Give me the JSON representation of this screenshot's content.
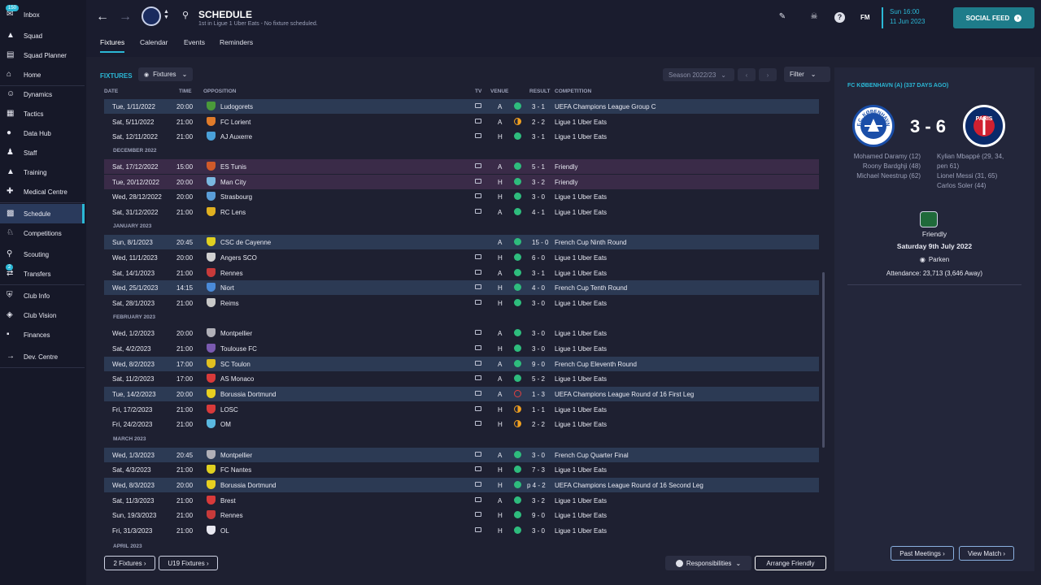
{
  "sidebar": [
    {
      "label": "Inbox",
      "badge": "150",
      "icon": "inbox-icon"
    },
    {
      "label": "Squad",
      "icon": "shirt-icon"
    },
    {
      "label": "Squad Planner",
      "icon": "clipboard-icon"
    },
    {
      "label": "Home",
      "icon": "home-icon"
    },
    {
      "label": "Dynamics",
      "icon": "dynamics-icon"
    },
    {
      "label": "Tactics",
      "icon": "tactics-icon"
    },
    {
      "label": "Data Hub",
      "icon": "data-hub-icon"
    },
    {
      "label": "Staff",
      "icon": "staff-icon"
    },
    {
      "label": "Training",
      "icon": "training-icon"
    },
    {
      "label": "Medical Centre",
      "icon": "medical-icon"
    },
    {
      "label": "Schedule",
      "icon": "calendar-icon"
    },
    {
      "label": "Competitions",
      "icon": "trophy-icon"
    },
    {
      "label": "Scouting",
      "icon": "scouting-icon"
    },
    {
      "label": "Transfers",
      "badge": "2",
      "icon": "transfers-icon"
    },
    {
      "label": "Club Info",
      "icon": "shield-icon"
    },
    {
      "label": "Club Vision",
      "icon": "vision-icon"
    },
    {
      "label": "Finances",
      "icon": "finances-icon"
    },
    {
      "label": "Dev. Centre",
      "icon": "dev-centre-icon"
    }
  ],
  "header": {
    "title": "SCHEDULE",
    "subtitle": "1st in Ligue 1 Uber Eats - No fixture scheduled.",
    "date_time": "Sun 16:00",
    "date": "11 Jun 2023",
    "social": "SOCIAL FEED",
    "fm": "FM"
  },
  "tabs": [
    "Fixtures",
    "Calendar",
    "Events",
    "Reminders"
  ],
  "main": {
    "section": "FIXTURES",
    "dropdown": "Fixtures",
    "season": "Season 2022/23",
    "filter": "Filter",
    "columns": {
      "date": "DATE",
      "time": "TIME",
      "opposition": "OPPOSITION",
      "tv": "TV",
      "venue": "VENUE",
      "result": "RESULT",
      "competition": "COMPETITION"
    }
  },
  "months": [
    "DECEMBER 2022",
    "JANUARY 2023",
    "FEBRUARY 2023",
    "MARCH 2023",
    "APRIL 2023"
  ],
  "fixtures": [
    {
      "date": "Tue, 1/11/2022",
      "time": "20:00",
      "opp": "Ludogorets",
      "venue": "A",
      "res": "3 - 1",
      "comp": "UEFA Champions League Group C",
      "dot": "#2ebc7d",
      "badge": "#4a9a3a",
      "style": "hl",
      "tv": true
    },
    {
      "date": "Sat, 5/11/2022",
      "time": "21:00",
      "opp": "FC Lorient",
      "venue": "A",
      "res": "2 - 2",
      "comp": "Ligue 1 Uber Eats",
      "dot": "half",
      "badge": "#e07b2a",
      "style": "",
      "tv": true
    },
    {
      "date": "Sat, 12/11/2022",
      "time": "21:00",
      "opp": "AJ Auxerre",
      "venue": "H",
      "res": "3 - 1",
      "comp": "Ligue 1 Uber Eats",
      "dot": "#2ebc7d",
      "badge": "#4aa0d8",
      "style": "",
      "tv": true
    },
    {
      "date": "Sat, 17/12/2022",
      "time": "15:00",
      "opp": "ES Tunis",
      "venue": "A",
      "res": "5 - 1",
      "comp": "Friendly",
      "dot": "#2ebc7d",
      "badge": "#d05a2a",
      "style": "pk",
      "tv": true
    },
    {
      "date": "Tue, 20/12/2022",
      "time": "20:00",
      "opp": "Man City",
      "venue": "H",
      "res": "3 - 2",
      "comp": "Friendly",
      "dot": "#2ebc7d",
      "badge": "#7ab8e0",
      "style": "pk",
      "tv": true
    },
    {
      "date": "Wed, 28/12/2022",
      "time": "20:00",
      "opp": "Strasbourg",
      "venue": "H",
      "res": "3 - 0",
      "comp": "Ligue 1 Uber Eats",
      "dot": "#2ebc7d",
      "badge": "#5a9ed8",
      "style": "",
      "tv": true
    },
    {
      "date": "Sat, 31/12/2022",
      "time": "21:00",
      "opp": "RC Lens",
      "venue": "A",
      "res": "4 - 1",
      "comp": "Ligue 1 Uber Eats",
      "dot": "#2ebc7d",
      "badge": "#e0b020",
      "style": "",
      "tv": true
    },
    {
      "date": "Sun, 8/1/2023",
      "time": "20:45",
      "opp": "CSC de Cayenne",
      "venue": "A",
      "res": "15 - 0",
      "comp": "French Cup Ninth Round",
      "dot": "#2ebc7d",
      "badge": "#e0d020",
      "style": "hl",
      "tv": false
    },
    {
      "date": "Wed, 11/1/2023",
      "time": "20:00",
      "opp": "Angers SCO",
      "venue": "H",
      "res": "6 - 0",
      "comp": "Ligue 1 Uber Eats",
      "dot": "#2ebc7d",
      "badge": "#d0d0d0",
      "style": "",
      "tv": true
    },
    {
      "date": "Sat, 14/1/2023",
      "time": "21:00",
      "opp": "Rennes",
      "venue": "A",
      "res": "3 - 1",
      "comp": "Ligue 1 Uber Eats",
      "dot": "#2ebc7d",
      "badge": "#c83a3a",
      "style": "",
      "tv": true
    },
    {
      "date": "Wed, 25/1/2023",
      "time": "14:15",
      "opp": "Niort",
      "venue": "H",
      "res": "4 - 0",
      "comp": "French Cup Tenth Round",
      "dot": "#2ebc7d",
      "badge": "#4a8ad8",
      "style": "hl",
      "tv": true
    },
    {
      "date": "Sat, 28/1/2023",
      "time": "21:00",
      "opp": "Reims",
      "venue": "H",
      "res": "3 - 0",
      "comp": "Ligue 1 Uber Eats",
      "dot": "#2ebc7d",
      "badge": "#c8c8c8",
      "style": "",
      "tv": true
    },
    {
      "date": "Wed, 1/2/2023",
      "time": "20:00",
      "opp": "Montpellier",
      "venue": "A",
      "res": "3 - 0",
      "comp": "Ligue 1 Uber Eats",
      "dot": "#2ebc7d",
      "badge": "#b0b0b8",
      "style": "",
      "tv": true
    },
    {
      "date": "Sat, 4/2/2023",
      "time": "21:00",
      "opp": "Toulouse FC",
      "venue": "H",
      "res": "3 - 0",
      "comp": "Ligue 1 Uber Eats",
      "dot": "#2ebc7d",
      "badge": "#7a5ab0",
      "style": "",
      "tv": true
    },
    {
      "date": "Wed, 8/2/2023",
      "time": "17:00",
      "opp": "SC Toulon",
      "venue": "A",
      "res": "9 - 0",
      "comp": "French Cup Eleventh Round",
      "dot": "#2ebc7d",
      "badge": "#e0c020",
      "style": "hl",
      "tv": true
    },
    {
      "date": "Sat, 11/2/2023",
      "time": "17:00",
      "opp": "AS Monaco",
      "venue": "A",
      "res": "5 - 2",
      "comp": "Ligue 1 Uber Eats",
      "dot": "#2ebc7d",
      "badge": "#d83a3a",
      "style": "",
      "tv": true
    },
    {
      "date": "Tue, 14/2/2023",
      "time": "20:00",
      "opp": "Borussia Dortmund",
      "venue": "A",
      "res": "1 - 3",
      "comp": "UEFA Champions League Round of 16  First Leg",
      "dot": "loss",
      "badge": "#e8d020",
      "style": "hl",
      "tv": true
    },
    {
      "date": "Fri, 17/2/2023",
      "time": "21:00",
      "opp": "LOSC",
      "venue": "H",
      "res": "1 - 1",
      "comp": "Ligue 1 Uber Eats",
      "dot": "half",
      "badge": "#d83a3a",
      "style": "",
      "tv": true
    },
    {
      "date": "Fri, 24/2/2023",
      "time": "21:00",
      "opp": "OM",
      "venue": "H",
      "res": "2 - 2",
      "comp": "Ligue 1 Uber Eats",
      "dot": "half",
      "badge": "#5ab8e0",
      "style": "",
      "tv": true
    },
    {
      "date": "Wed, 1/3/2023",
      "time": "20:45",
      "opp": "Montpellier",
      "venue": "A",
      "res": "3 - 0",
      "comp": "French Cup Quarter Final",
      "dot": "#2ebc7d",
      "badge": "#b0b0b8",
      "style": "hl",
      "tv": true
    },
    {
      "date": "Sat, 4/3/2023",
      "time": "21:00",
      "opp": "FC Nantes",
      "venue": "H",
      "res": "7 - 3",
      "comp": "Ligue 1 Uber Eats",
      "dot": "#2ebc7d",
      "badge": "#e0d020",
      "style": "",
      "tv": true
    },
    {
      "date": "Wed, 8/3/2023",
      "time": "20:00",
      "opp": "Borussia Dortmund",
      "venue": "H",
      "res": "p 4 - 2",
      "comp": "UEFA Champions League Round of 16  Second Leg",
      "dot": "#2ebc7d",
      "badge": "#e8d020",
      "style": "hl",
      "tv": true
    },
    {
      "date": "Sat, 11/3/2023",
      "time": "21:00",
      "opp": "Brest",
      "venue": "A",
      "res": "3 - 2",
      "comp": "Ligue 1 Uber Eats",
      "dot": "#2ebc7d",
      "badge": "#d83a3a",
      "style": "",
      "tv": true
    },
    {
      "date": "Sun, 19/3/2023",
      "time": "21:00",
      "opp": "Rennes",
      "venue": "H",
      "res": "9 - 0",
      "comp": "Ligue 1 Uber Eats",
      "dot": "#2ebc7d",
      "badge": "#c83a3a",
      "style": "",
      "tv": true
    },
    {
      "date": "Fri, 31/3/2023",
      "time": "21:00",
      "opp": "OL",
      "venue": "H",
      "res": "3 - 0",
      "comp": "Ligue 1 Uber Eats",
      "dot": "#2ebc7d",
      "badge": "#e8e8f0",
      "style": "",
      "tv": true
    }
  ],
  "footer": {
    "btn1": "2 Fixtures",
    "btn2": "U19 Fixtures",
    "responsibilities": "Responsibilities",
    "arrange": "Arrange Friendly"
  },
  "panel": {
    "title": "FC KØBENHAVN (A) (337 DAYS AGO)",
    "score": "3 - 6",
    "home_scorers": [
      "Mohamed Daramy (12)",
      "Roony Bardghji (48)",
      "Michael Neestrup (62)"
    ],
    "away_scorers": [
      "Kylian Mbappé (29, 34,",
      "pen 61)",
      "Lionel Messi (31, 65)",
      "Carlos Soler (44)"
    ],
    "competition": "Friendly",
    "date": "Saturday 9th July 2022",
    "venue": "Parken",
    "attendance": "Attendance: 23,713 (3,646 Away)",
    "home_logo_text": "F.C. KØBENHAVN",
    "away_logo_text": "PARIS",
    "past": "Past Meetings",
    "view": "View Match"
  }
}
